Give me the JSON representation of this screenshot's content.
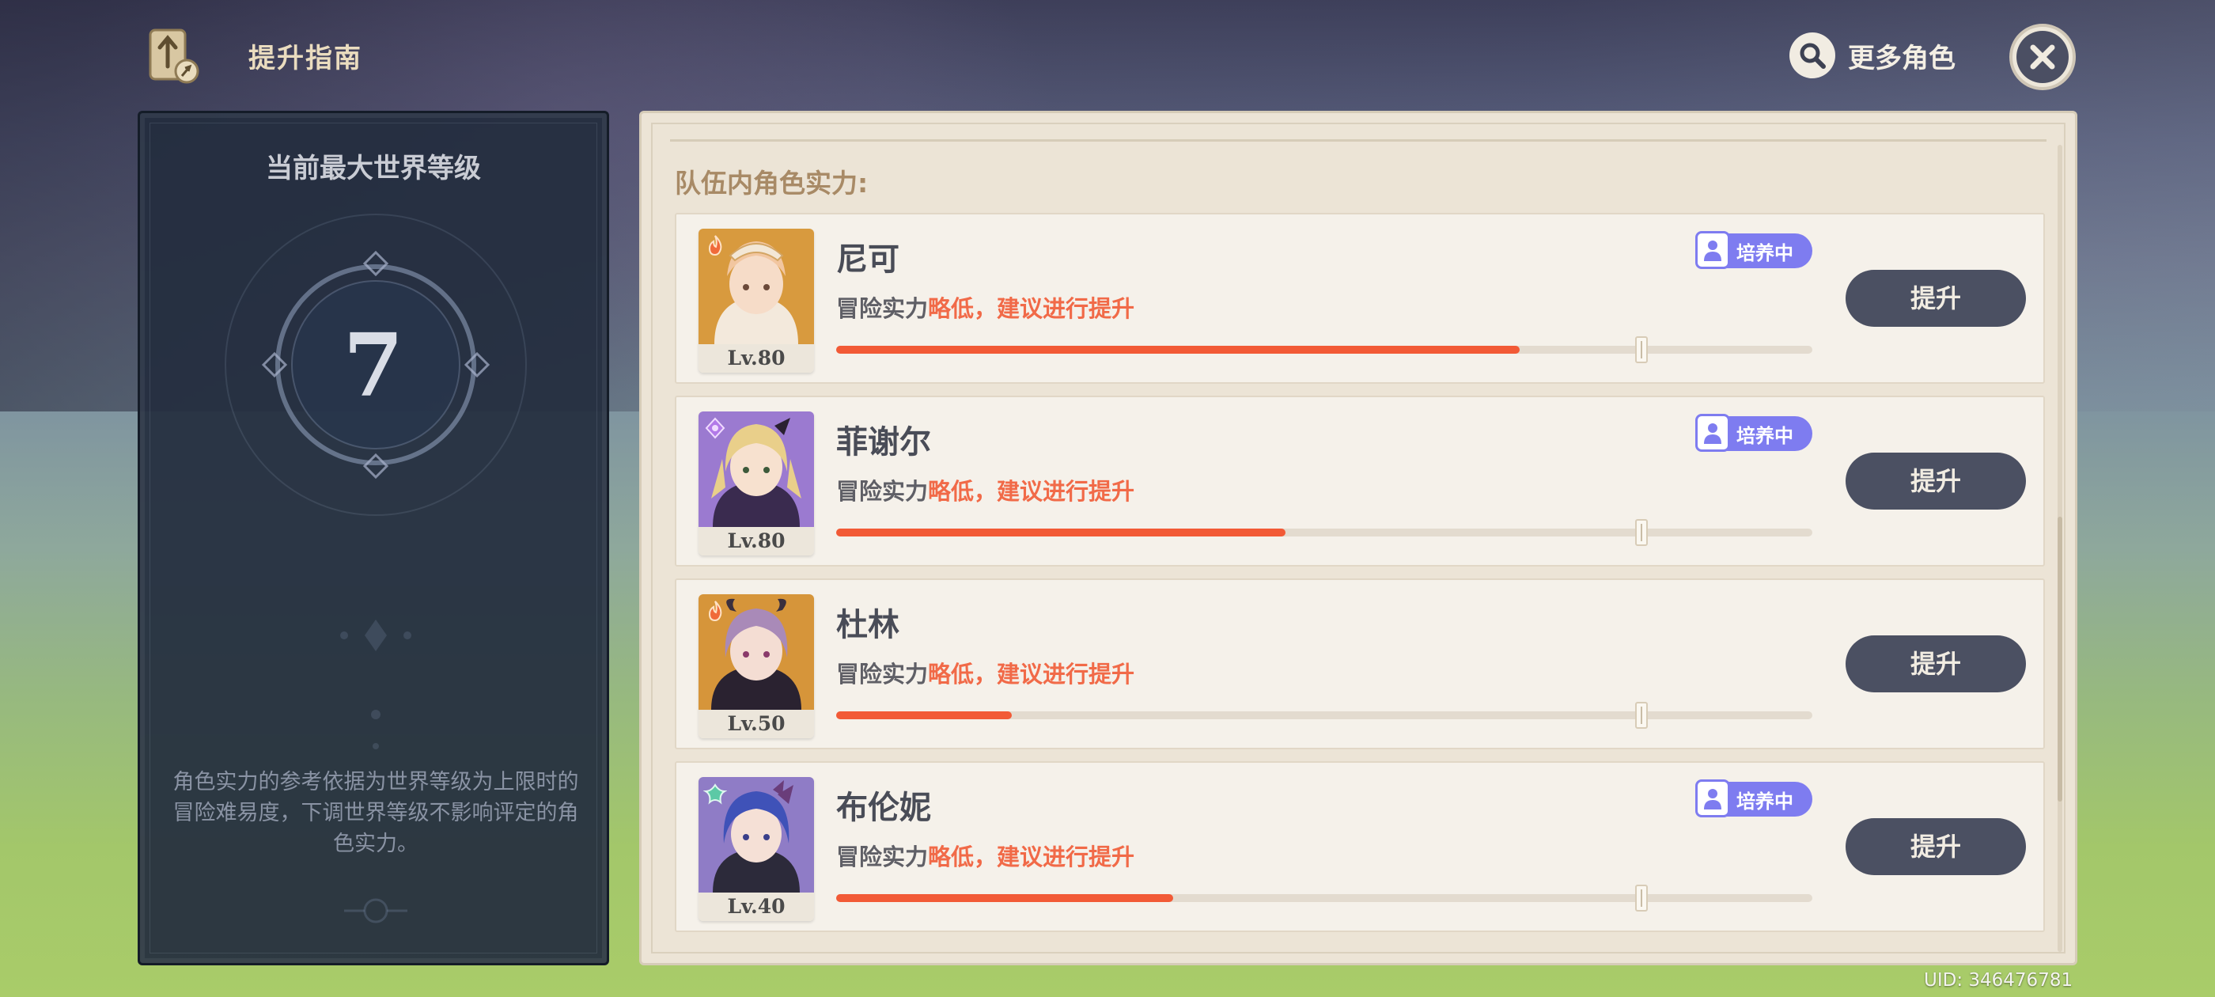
{
  "header": {
    "title": "提升指南",
    "more_characters": "更多角色"
  },
  "world_level": {
    "title": "当前最大世界等级",
    "value": "7",
    "description": "角色实力的参考依据为世界等级为上限时的冒险难易度，下调世界等级不影响评定的角色实力。"
  },
  "team": {
    "section_title": "队伍内角色实力:",
    "power_prefix": "冒险实力",
    "power_warning": "略低，建议进行提升",
    "upgrade_label": "提升",
    "training_label": "培养中",
    "accent_color": "#f25a36",
    "characters": [
      {
        "name": "尼可",
        "level": "Lv.80",
        "element": "pyro",
        "training": true,
        "progress": 0.7,
        "recommended": 0.825
      },
      {
        "name": "菲谢尔",
        "level": "Lv.80",
        "element": "electro",
        "training": true,
        "progress": 0.46,
        "recommended": 0.825
      },
      {
        "name": "杜林",
        "level": "Lv.50",
        "element": "pyro",
        "training": false,
        "progress": 0.18,
        "recommended": 0.825
      },
      {
        "name": "布伦妮",
        "level": "Lv.40",
        "element": "anemo",
        "training": true,
        "progress": 0.345,
        "recommended": 0.825
      }
    ]
  },
  "footer": {
    "uid": "UID: 346476781"
  }
}
